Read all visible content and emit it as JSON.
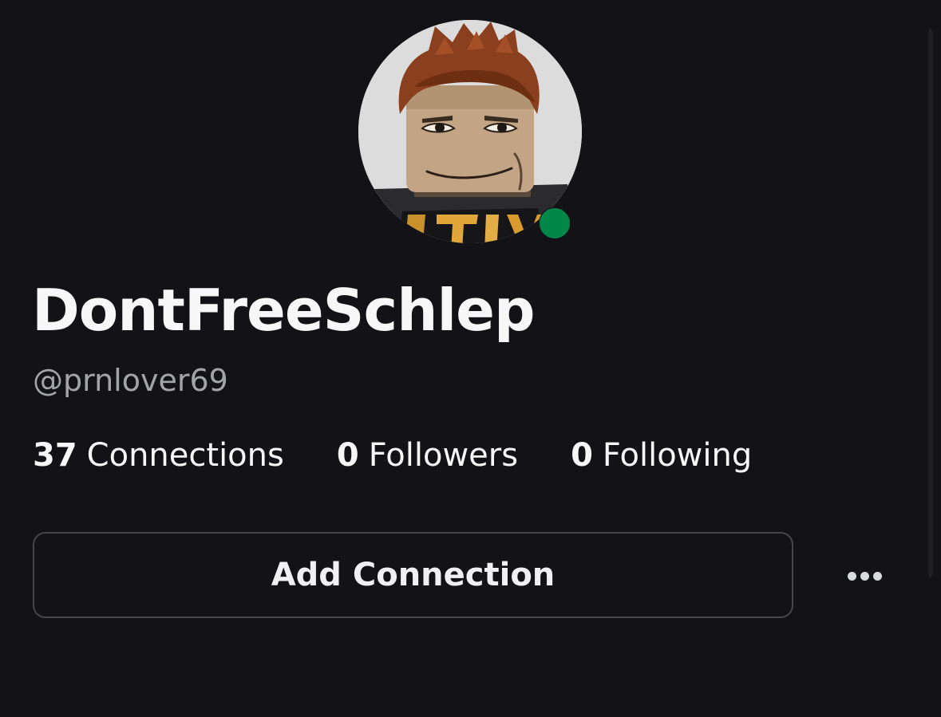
{
  "profile": {
    "display_name": "DontFreeSchlep",
    "username": "@prnlover69",
    "online": true,
    "presence_color": "#02874a",
    "avatar_icon": "roblox-avatar-headshot"
  },
  "stats": [
    {
      "count": "37",
      "label": "Connections"
    },
    {
      "count": "0",
      "label": "Followers"
    },
    {
      "count": "0",
      "label": "Following"
    }
  ],
  "actions": {
    "add_connection_label": "Add Connection",
    "more_icon": "more-horizontal-icon"
  },
  "theme": {
    "background": "#121217",
    "text_primary": "#f7f7f8",
    "text_secondary": "#a3a4a8",
    "button_border": "#45464c"
  }
}
